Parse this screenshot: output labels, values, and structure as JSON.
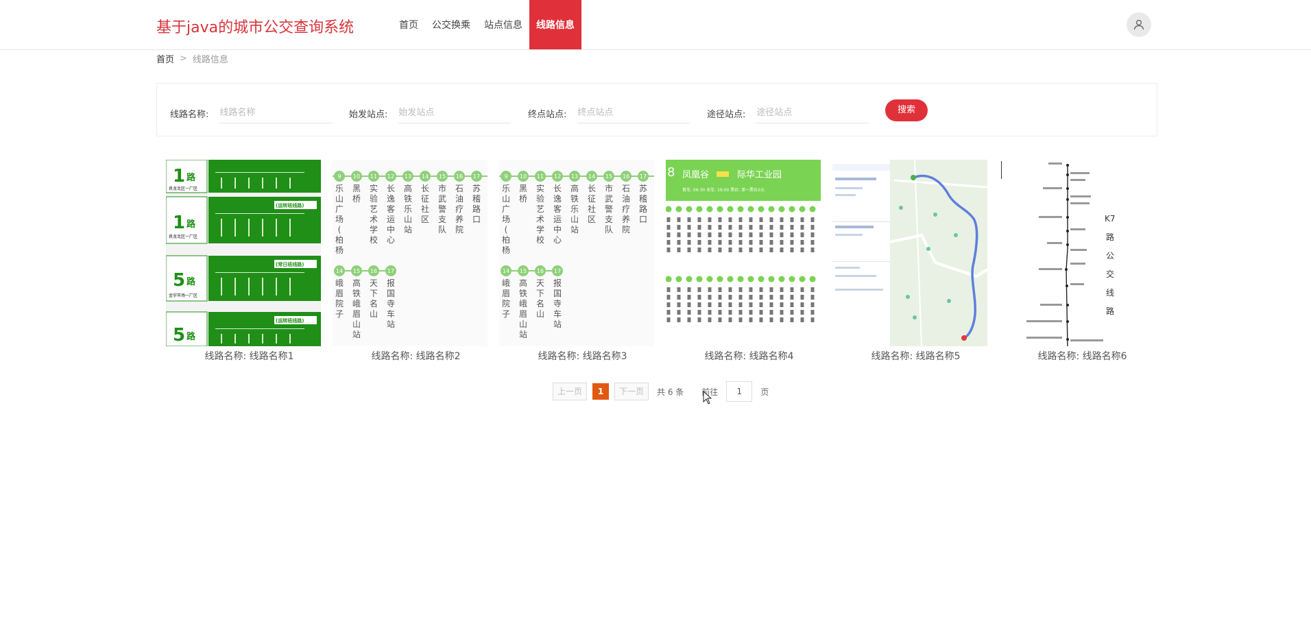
{
  "header": {
    "brand": "基于java的城市公交查询系统",
    "nav": [
      "首页",
      "公交换乘",
      "站点信息",
      "线路信息"
    ],
    "active_index": 3
  },
  "breadcrumb": {
    "home": "首页",
    "separator": ">",
    "current": "线路信息"
  },
  "search": {
    "fields": [
      {
        "label": "线路名称:",
        "placeholder": "线路名称"
      },
      {
        "label": "始发站点:",
        "placeholder": "始发站点"
      },
      {
        "label": "终点站点:",
        "placeholder": "终点站点"
      },
      {
        "label": "途径站点:",
        "placeholder": "途径站点"
      }
    ],
    "button": "搜索"
  },
  "cards": [
    {
      "caption": "线路名称:  线路名称1",
      "image": "green-bus-route-boards"
    },
    {
      "caption": "线路名称:  线路名称2",
      "image": "bus-stop-sequence-board"
    },
    {
      "caption": "线路名称:  线路名称3",
      "image": "bus-stop-sequence-board"
    },
    {
      "caption": "线路名称:  线路名称4",
      "image": "green-route-sign"
    },
    {
      "caption": "线路名称:  线路名称5",
      "image": "route-map-screenshot"
    },
    {
      "caption": "线路名称:  线路名称6",
      "image": "k7-route-diagram"
    }
  ],
  "images": {
    "board_routes": [
      {
        "num": "1",
        "sub": "良龙北区一厂区",
        "tag": ""
      },
      {
        "num": "1",
        "sub": "良龙北区一厂区",
        "tag": "(运转班线路)"
      },
      {
        "num": "5",
        "sub": "金宇市场一厂区",
        "tag": "(常日班线路)"
      },
      {
        "num": "5",
        "sub": "",
        "tag": "(运转班线路)"
      }
    ],
    "board_unit": "路",
    "stop_numbers_top": [
      "9",
      "10",
      "11",
      "12",
      "13",
      "14",
      "15",
      "16",
      "17"
    ],
    "stop_numbers_bottom": [
      "14",
      "15",
      "16",
      "17"
    ],
    "stops_top": [
      "乐山广场(柏杨",
      "黑桥",
      "实验艺术学校",
      "长逸客运中心",
      "高铁乐山站",
      "长征社区",
      "市武警支队",
      "石油疗养院",
      "苏稽路口"
    ],
    "stops_bottom": [
      "峨眉院子",
      "高铁峨眉山站",
      "天下名山",
      "报国寺车站"
    ],
    "sign_from": "凤凰谷",
    "sign_to": "际华工业园",
    "sign_time": "首车: 06:30    末车: 19:00    票价: 单一票价2元",
    "sign_route_num": "8",
    "k7_title": [
      "K7",
      "路",
      "公",
      "交",
      "线",
      "路"
    ]
  },
  "pagination": {
    "prev": "上一页",
    "current": "1",
    "next": "下一页",
    "total": "共 6 条",
    "goto": "前往",
    "page_value": "1",
    "page_unit": "页"
  },
  "colors": {
    "accent": "#e0303a",
    "page_active": "#e05a12",
    "board_green": "#1f8f17",
    "sign_green": "#7ad352"
  }
}
